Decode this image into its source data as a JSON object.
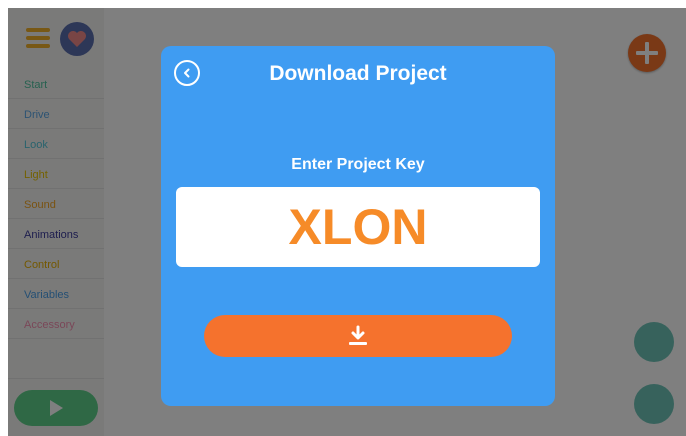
{
  "sidebar": {
    "categories": [
      {
        "label": "Start",
        "color": "#4fc3a0"
      },
      {
        "label": "Drive",
        "color": "#5aa7e6"
      },
      {
        "label": "Look",
        "color": "#53c6da"
      },
      {
        "label": "Light",
        "color": "#e8c300"
      },
      {
        "label": "Sound",
        "color": "#f5a623"
      },
      {
        "label": "Animations",
        "color": "#3c3c9c"
      },
      {
        "label": "Control",
        "color": "#e8b000"
      },
      {
        "label": "Variables",
        "color": "#4a9fe8"
      },
      {
        "label": "Accessory",
        "color": "#f48fb1"
      }
    ]
  },
  "icons": {
    "menu": "hamburger-menu-icon",
    "profile": "heart-icon",
    "play": "play-icon",
    "add": "plus-icon",
    "back": "chevron-left-icon",
    "download": "download-icon"
  },
  "modal": {
    "title": "Download Project",
    "key_label": "Enter Project Key",
    "key_value": "XLON"
  },
  "colors": {
    "modal_background": "#3f9cf2",
    "accent_orange": "#f5722d",
    "key_text": "#f68b28"
  }
}
